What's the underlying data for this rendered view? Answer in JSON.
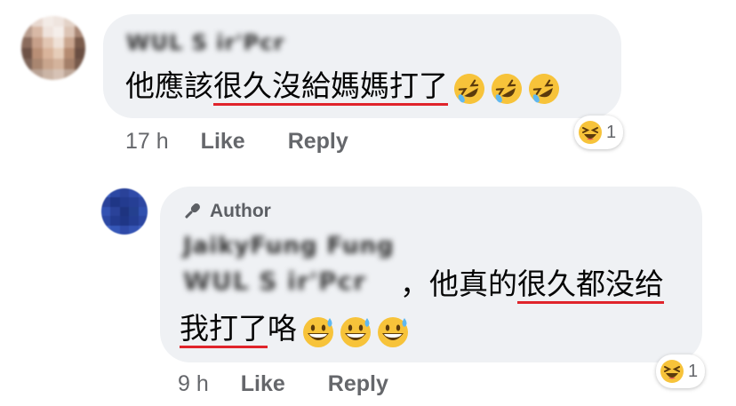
{
  "comments": [
    {
      "author_name": "WUL S ir'Pcr",
      "text_pre": "他應該",
      "text_underlined": "很久沒給媽媽打了",
      "emojis": [
        "rolling-on-floor-laughing",
        "rolling-on-floor-laughing",
        "rolling-on-floor-laughing"
      ],
      "time": "17 h",
      "like_label": "Like",
      "reply_label": "Reply",
      "reaction": {
        "icon": "laughing-face",
        "count": "1"
      }
    },
    {
      "badge_label": "Author",
      "author_name": "JaikyFung Fung",
      "mention": "WUL S ir'Pcr",
      "text_line1_pre": "，他真的",
      "text_line1_underlined": "很久都没给",
      "text_line2_underlined": "我打了",
      "text_line2_post": "咯",
      "emojis": [
        "grinning-sweat",
        "grinning-sweat",
        "grinning-sweat"
      ],
      "time": "9 h",
      "like_label": "Like",
      "reply_label": "Reply",
      "reaction": {
        "icon": "laughing-face",
        "count": "1"
      }
    }
  ],
  "colors": {
    "bubble": "#eff1f4",
    "meta_text": "#65676b",
    "underline": "#e0242b",
    "author_avatar": "#2f4aa8"
  }
}
